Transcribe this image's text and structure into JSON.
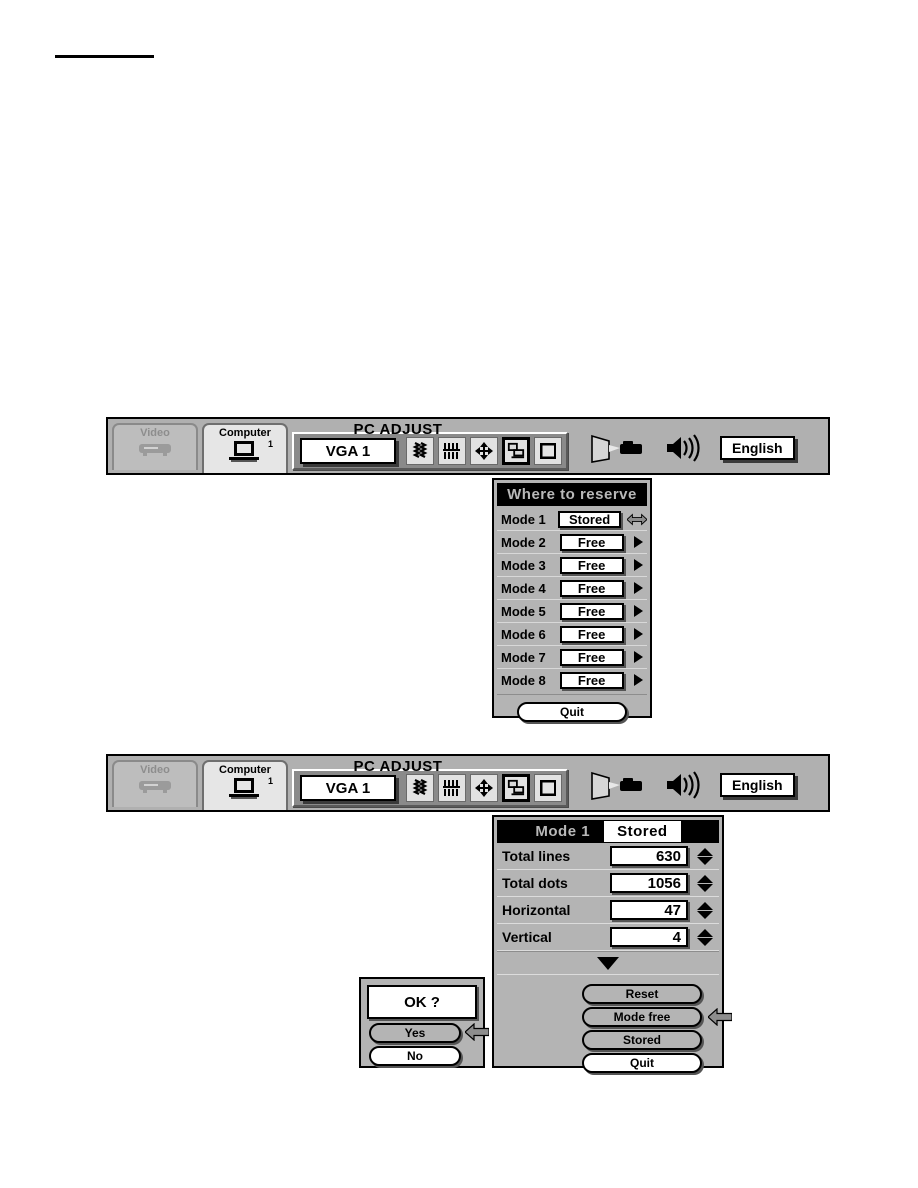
{
  "page": {
    "background": "#ffffff",
    "accent_black": "#000000",
    "panel_grey": "#b4b4b4",
    "toolbar_grey": "#8a8a8a"
  },
  "osd": {
    "title": "PC ADJUST",
    "tabs": [
      {
        "label": "Video",
        "icon": "vcr-icon",
        "state": "inactive",
        "sup": ""
      },
      {
        "label": "Computer",
        "icon": "laptop-icon",
        "state": "active",
        "sup": "1"
      }
    ],
    "source_value": "VGA 1",
    "toolbar_icons": [
      {
        "name": "fine-sync-icon",
        "selected": false
      },
      {
        "name": "total-dots-icon",
        "selected": false
      },
      {
        "name": "position-arrows-icon",
        "selected": false
      },
      {
        "name": "pc-adjust-icon",
        "selected": true
      },
      {
        "name": "screen-icon",
        "selected": false
      }
    ],
    "right_icons": [
      {
        "name": "projector-screen-icon"
      },
      {
        "name": "volume-speaker-icon"
      }
    ],
    "language_button": "English"
  },
  "reserve_panel": {
    "title": "Where to reserve",
    "rows": [
      {
        "label": "Mode 1",
        "value": "Stored",
        "marker": "double-arrow"
      },
      {
        "label": "Mode 2",
        "value": "Free",
        "marker": "triangle-right"
      },
      {
        "label": "Mode 3",
        "value": "Free",
        "marker": "triangle-right"
      },
      {
        "label": "Mode 4",
        "value": "Free",
        "marker": "triangle-right"
      },
      {
        "label": "Mode 5",
        "value": "Free",
        "marker": "triangle-right"
      },
      {
        "label": "Mode 6",
        "value": "Free",
        "marker": "triangle-right"
      },
      {
        "label": "Mode 7",
        "value": "Free",
        "marker": "triangle-right"
      },
      {
        "label": "Mode 8",
        "value": "Free",
        "marker": "triangle-right"
      }
    ],
    "quit_button": "Quit"
  },
  "mode_panel": {
    "title_mode": "Mode 1",
    "title_state": "Stored",
    "values": [
      {
        "label": "Total lines",
        "value": "630"
      },
      {
        "label": "Total dots",
        "value": "1056"
      },
      {
        "label": "Horizontal",
        "value": "47"
      },
      {
        "label": "Vertical",
        "value": "4"
      }
    ],
    "buttons": [
      {
        "label": "Reset",
        "style": "grey",
        "marker": ""
      },
      {
        "label": "Mode free",
        "style": "grey",
        "marker": "left-arrow"
      },
      {
        "label": "Stored",
        "style": "grey",
        "marker": ""
      },
      {
        "label": "Quit",
        "style": "white",
        "marker": ""
      }
    ]
  },
  "confirm_dialog": {
    "prompt": "OK ?",
    "yes_label": "Yes",
    "no_label": "No",
    "marker": "left-arrow"
  }
}
